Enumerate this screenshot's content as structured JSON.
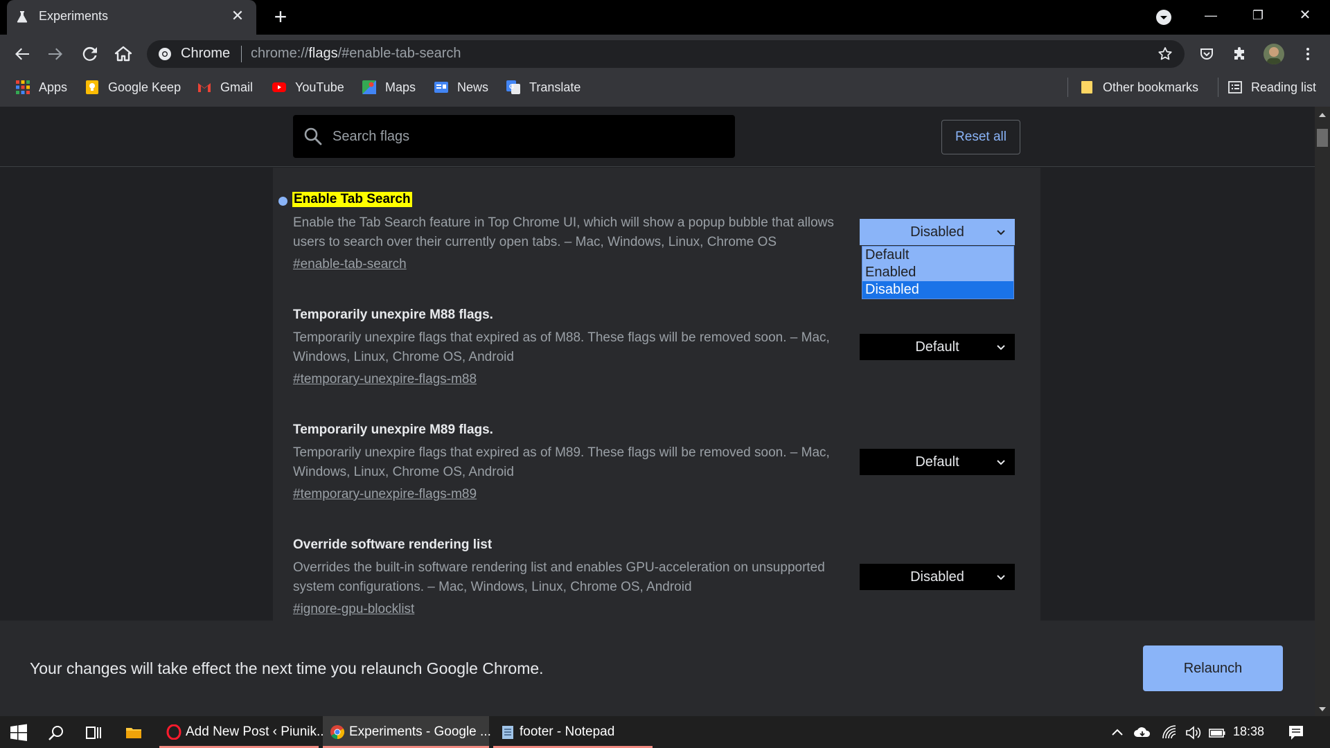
{
  "tab": {
    "title": "Experiments",
    "close_label": "✕",
    "new_tab_label": "+"
  },
  "window_controls": {
    "minimize": "—",
    "restore": "❐",
    "close": "✕"
  },
  "omnibox": {
    "site_label": "Chrome",
    "url_prefix": "chrome://",
    "url_host": "flags",
    "url_rest": "/#enable-tab-search"
  },
  "bookmarks": [
    {
      "label": "Apps",
      "icon": "apps-grid-icon"
    },
    {
      "label": "Google Keep",
      "icon": "google-keep-icon"
    },
    {
      "label": "Gmail",
      "icon": "gmail-icon"
    },
    {
      "label": "YouTube",
      "icon": "youtube-icon"
    },
    {
      "label": "Maps",
      "icon": "maps-icon"
    },
    {
      "label": "News",
      "icon": "news-icon"
    },
    {
      "label": "Translate",
      "icon": "translate-icon"
    }
  ],
  "other_bookmarks": "Other bookmarks",
  "reading_list": "Reading list",
  "search": {
    "placeholder": "Search flags"
  },
  "reset_all": "Reset all",
  "flags": [
    {
      "title": "Enable Tab Search",
      "desc": "Enable the Tab Search feature in Top Chrome UI, which will show a popup bubble that allows users to search over their currently open tabs. – Mac, Windows, Linux, Chrome OS",
      "link": "#enable-tab-search",
      "value": "Disabled"
    },
    {
      "title": "Temporarily unexpire M88 flags.",
      "desc": "Temporarily unexpire flags that expired as of M88. These flags will be removed soon. – Mac, Windows, Linux, Chrome OS, Android",
      "link": "#temporary-unexpire-flags-m88",
      "value": "Default"
    },
    {
      "title": "Temporarily unexpire M89 flags.",
      "desc": "Temporarily unexpire flags that expired as of M89. These flags will be removed soon. – Mac, Windows, Linux, Chrome OS, Android",
      "link": "#temporary-unexpire-flags-m89",
      "value": "Default"
    },
    {
      "title": "Override software rendering list",
      "desc": "Overrides the built-in software rendering list and enables GPU-acceleration on unsupported system configurations. – Mac, Windows, Linux, Chrome OS, Android",
      "link": "#ignore-gpu-blocklist",
      "value": "Disabled"
    }
  ],
  "dropdown_options": [
    "Default",
    "Enabled",
    "Disabled"
  ],
  "dropdown_selected": "Disabled",
  "relaunch": {
    "message": "Your changes will take effect the next time you relaunch Google Chrome.",
    "button": "Relaunch"
  },
  "taskbar": {
    "apps": [
      {
        "label": "Add New Post ‹ Piunik...",
        "icon": "opera-icon"
      },
      {
        "label": "Experiments - Google ...",
        "icon": "chrome-icon"
      },
      {
        "label": "footer - Notepad",
        "icon": "notepad-icon"
      }
    ],
    "clock": "18:38"
  },
  "colors": {
    "accent": "#8ab4f8",
    "highlight": "#ffff00",
    "selected_option": "#1a73e8"
  }
}
